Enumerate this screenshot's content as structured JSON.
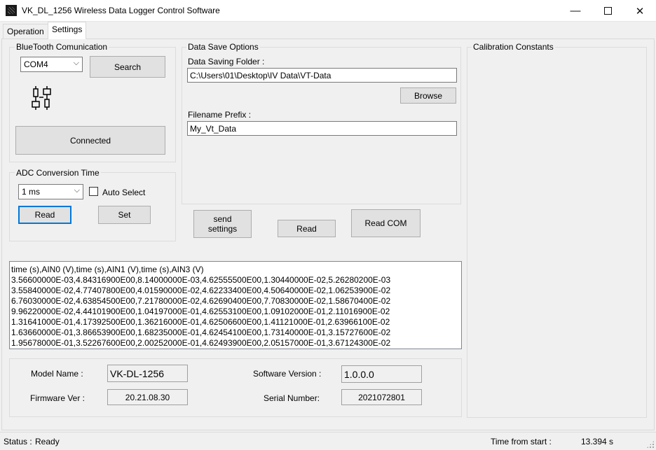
{
  "window": {
    "title": "VK_DL_1256 Wireless Data Logger Control Software",
    "min_glyph": "—",
    "close_glyph": "✕"
  },
  "tabs": [
    {
      "label": "Operation",
      "active": false
    },
    {
      "label": "Settings",
      "active": true
    }
  ],
  "bluetooth": {
    "group_label": "BlueTooth Comunication",
    "port_selected": "COM4",
    "search_label": "Search",
    "status_button_label": "Connected"
  },
  "adc": {
    "group_label": "ADC Conversion Time",
    "time_selected": "1 ms",
    "auto_select_label": "Auto Select",
    "auto_select_checked": false,
    "read_label": "Read",
    "set_label": "Set"
  },
  "data_save": {
    "group_label": "Data Save Options",
    "folder_label": "Data Saving Folder :",
    "folder_value": "C:\\Users\\01\\Desktop\\IV Data\\VT-Data",
    "browse_label": "Browse",
    "prefix_label": "Filename Prefix :",
    "prefix_value": "My_Vt_Data"
  },
  "actions": {
    "send_settings_line1": "send",
    "send_settings_line2": "settings",
    "read_label": "Read",
    "read_com_label": "Read COM"
  },
  "calibration": {
    "group_label": "Calibration Constants"
  },
  "log_lines": [
    "time (s),AIN0 (V),time (s),AIN1 (V),time (s),AIN3 (V)",
    "3.56600000E-03,4.84316900E00,8.14000000E-03,4.62555500E00,1.30440000E-02,5.26280200E-03",
    "3.55840000E-02,4.77407800E00,4.01590000E-02,4.62233400E00,4.50640000E-02,1.06253900E-02",
    "6.76030000E-02,4.63854500E00,7.21780000E-02,4.62690400E00,7.70830000E-02,1.58670400E-02",
    "9.96220000E-02,4.44101900E00,1.04197000E-01,4.62553100E00,1.09102000E-01,2.11016900E-02",
    "1.31641000E-01,4.17392500E00,1.36216000E-01,4.62506600E00,1.41121000E-01,2.63966100E-02",
    "1.63660000E-01,3.86653900E00,1.68235000E-01,4.62454100E00,1.73140000E-01,3.15727600E-02",
    "1.95678000E-01,3.52267600E00,2.00252000E-01,4.62493900E00,2.05157000E-01,3.67124300E-02"
  ],
  "device_info": {
    "model_name_label": "Model Name :",
    "model_name_value": "VK-DL-1256",
    "firmware_label": "Firmware Ver :",
    "firmware_value": "20.21.08.30",
    "software_label": "Software Version :",
    "software_value": "1.0.0.0",
    "serial_label": "Serial Number:",
    "serial_value": "2021072801"
  },
  "status_bar": {
    "status_label": "Status :",
    "status_value": "Ready",
    "time_label": "Time from start :",
    "time_value": "13.394 s"
  }
}
